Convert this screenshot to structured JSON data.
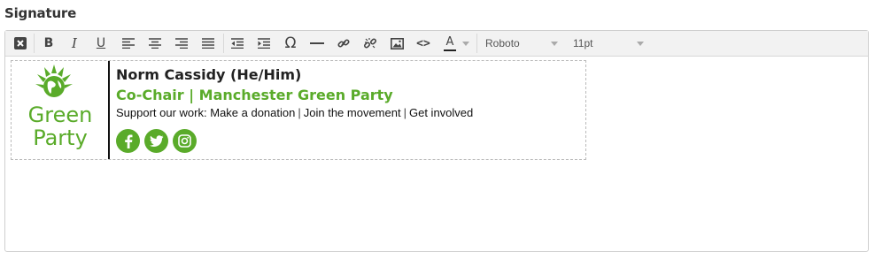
{
  "section": {
    "label": "Signature"
  },
  "toolbar": {
    "buttons": [
      {
        "name": "clear-formatting",
        "icon": "close-box-icon"
      },
      {
        "name": "bold",
        "glyph": "B"
      },
      {
        "name": "italic",
        "glyph": "I"
      },
      {
        "name": "underline",
        "glyph": "U"
      },
      {
        "name": "align-left",
        "icon": "align-left-icon"
      },
      {
        "name": "align-center",
        "icon": "align-center-icon"
      },
      {
        "name": "align-right",
        "icon": "align-right-icon"
      },
      {
        "name": "align-justify",
        "icon": "align-justify-icon"
      },
      {
        "name": "outdent",
        "icon": "outdent-icon"
      },
      {
        "name": "indent",
        "icon": "indent-icon"
      },
      {
        "name": "special-character",
        "glyph": "Ω"
      },
      {
        "name": "horizontal-line",
        "icon": "horizontal-line-icon"
      },
      {
        "name": "link",
        "icon": "link-icon"
      },
      {
        "name": "unlink",
        "icon": "unlink-icon"
      },
      {
        "name": "image",
        "icon": "image-icon"
      },
      {
        "name": "source-code",
        "glyph": "<>"
      },
      {
        "name": "text-color",
        "glyph": "A"
      }
    ],
    "font_family": "Roboto",
    "font_size": "11pt"
  },
  "signature": {
    "logo_line1": "Green",
    "logo_line2": "Party",
    "name": "Norm Cassidy (He/Him)",
    "role": "Co-Chair | Manchester Green Party",
    "support_prefix": "Support our work:",
    "links": [
      "Make a donation",
      "Join the movement",
      "Get involved"
    ],
    "separator": "|",
    "social": [
      "facebook-icon",
      "twitter-icon",
      "instagram-icon"
    ]
  },
  "colors": {
    "brand_green": "#5aab2a",
    "toolbar_bg": "#f2f2f2",
    "border": "#cfcfcf"
  }
}
